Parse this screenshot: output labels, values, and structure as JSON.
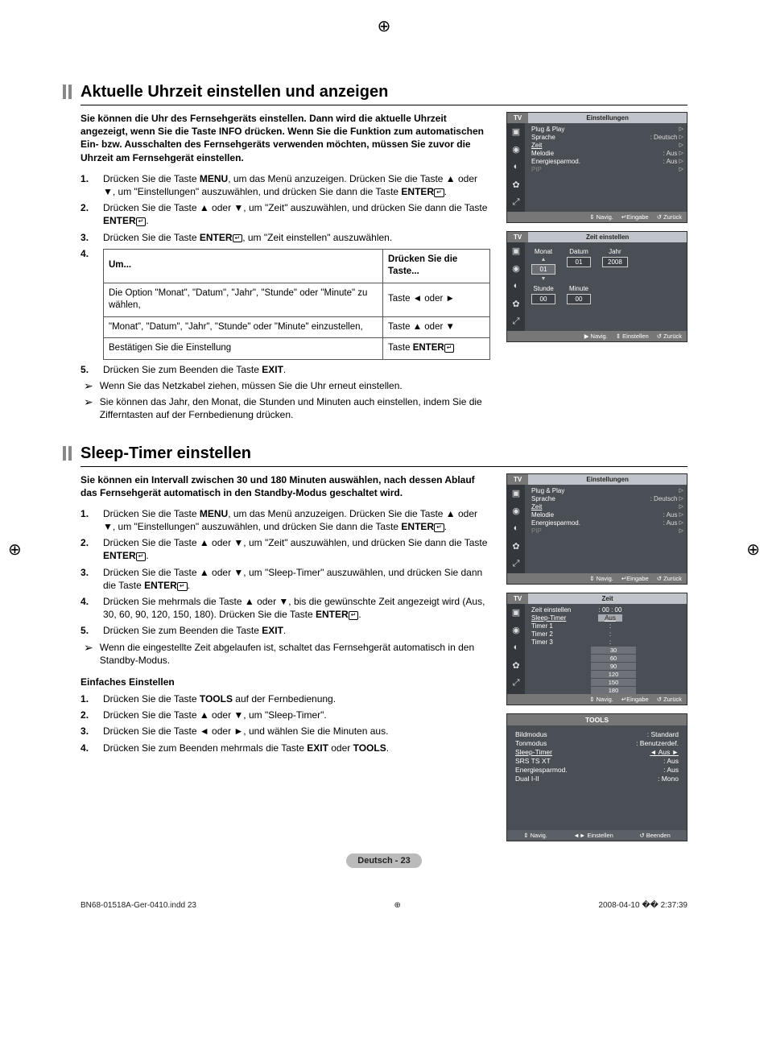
{
  "sections": [
    {
      "title": "Aktuelle Uhrzeit einstellen und anzeigen",
      "intro": "Sie können die Uhr des Fernsehgeräts einstellen. Dann wird die aktuelle Uhrzeit angezeigt, wenn Sie die Taste INFO drücken. Wenn Sie die Funktion zum automatischen Ein- bzw. Ausschalten des Fernsehgeräts verwenden möchten, müssen Sie zuvor die Uhrzeit am Fernsehgerät einstellen.",
      "steps": [
        "Drücken Sie die Taste **MENU**, um das Menü anzuzeigen. Drücken Sie die Taste ▲ oder ▼, um \"Einstellungen\" auszuwählen, und drücken Sie dann die Taste **ENTER**↵.",
        "Drücken Sie die Taste ▲ oder ▼, um \"Zeit\" auszuwählen, und drücken Sie dann die Taste **ENTER**↵.",
        "Drücken Sie die Taste **ENTER**↵, um \"Zeit einstellen\" auszuwählen."
      ],
      "table": {
        "headers": [
          "Um...",
          "Drücken Sie die Taste..."
        ],
        "rows": [
          [
            "Die Option \"Monat\", \"Datum\", \"Jahr\", \"Stunde\" oder \"Minute\" zu wählen,",
            "Taste ◄ oder ►"
          ],
          [
            "\"Monat\", \"Datum\", \"Jahr\", \"Stunde\" oder \"Minute\" einzustellen,",
            "Taste ▲ oder ▼"
          ],
          [
            "Bestätigen Sie die Einstellung",
            "Taste **ENTER**↵"
          ]
        ]
      },
      "step5": "Drücken Sie zum Beenden die Taste **EXIT**.",
      "notes": [
        "Wenn Sie das Netzkabel ziehen, müssen Sie die Uhr erneut einstellen.",
        "Sie können das Jahr, den Monat, die Stunden und Minuten auch einstellen, indem Sie die Zifferntasten auf der Fernbedienung drücken."
      ]
    },
    {
      "title": "Sleep-Timer einstellen",
      "intro": "Sie können ein Intervall zwischen 30 und 180 Minuten auswählen, nach dessen Ablauf das Fernsehgerät automatisch in den Standby-Modus geschaltet wird.",
      "steps": [
        "Drücken Sie die Taste **MENU**, um das Menü anzuzeigen. Drücken Sie die Taste ▲ oder ▼, um \"Einstellungen\" auszuwählen, und drücken Sie dann die Taste **ENTER**↵.",
        "Drücken Sie die Taste ▲ oder ▼, um \"Zeit\" auszuwählen, und drücken Sie dann die Taste **ENTER**↵.",
        "Drücken Sie die Taste ▲ oder ▼, um \"Sleep-Timer\" auszuwählen, und drücken Sie dann die Taste **ENTER**↵.",
        "Drücken Sie mehrmals die Taste ▲ oder ▼, bis die gewünschte Zeit angezeigt wird (Aus, 30, 60, 90, 120, 150, 180). Drücken Sie die Taste **ENTER**↵.",
        "Drücken Sie zum Beenden die Taste **EXIT**."
      ],
      "notes": [
        "Wenn die eingestellte Zeit abgelaufen ist, schaltet das Fernsehgerät automatisch in den Standby-Modus."
      ],
      "subhead": "Einfaches Einstellen",
      "substeps": [
        "Drücken Sie die Taste **TOOLS** auf der Fernbedienung.",
        "Drücken Sie die Taste ▲ oder ▼, um \"Sleep-Timer\".",
        "Drücken Sie die Taste ◄ oder ►, und wählen Sie die Minuten aus.",
        "Drücken Sie zum Beenden mehrmals die Taste **EXIT** oder **TOOLS**."
      ]
    }
  ],
  "osd": {
    "settings": {
      "tab": "TV",
      "title": "Einstellungen",
      "items": [
        {
          "k": "Plug & Play",
          "v": ""
        },
        {
          "k": "Sprache",
          "v": ": Deutsch"
        },
        {
          "k": "Zeit",
          "v": "",
          "hl": true
        },
        {
          "k": "Melodie",
          "v": ": Aus"
        },
        {
          "k": "Energiesparmod.",
          "v": ": Aus"
        },
        {
          "k": "PIP",
          "v": "",
          "dim": true
        }
      ],
      "footer": [
        "⇕ Navig.",
        "↵Eingabe",
        "↺ Zurück"
      ]
    },
    "zeit_einstellen": {
      "tab": "TV",
      "title": "Zeit einstellen",
      "cols": [
        {
          "label": "Monat",
          "val": "01",
          "hl": true,
          "arrows": true
        },
        {
          "label": "Datum",
          "val": "01"
        },
        {
          "label": "Jahr",
          "val": "2008"
        }
      ],
      "cols2": [
        {
          "label": "Stunde",
          "val": "00"
        },
        {
          "label": "Minute",
          "val": "00"
        }
      ],
      "footer": [
        "▶ Navig.",
        "⇕ Einstellen",
        "↺ Zurück"
      ]
    },
    "zeit_menu": {
      "tab": "TV",
      "title": "Zeit",
      "rows": [
        {
          "k": "Zeit einstellen",
          "v": ": 00 : 00"
        },
        {
          "k": "Sleep-Timer",
          "v": "Aus",
          "hl": true
        },
        {
          "k": "Timer 1",
          "v": ":"
        },
        {
          "k": "Timer 2",
          "v": ":"
        },
        {
          "k": "Timer 3",
          "v": ":"
        }
      ],
      "options": [
        "30",
        "60",
        "90",
        "120",
        "150",
        "180"
      ],
      "footer": [
        "⇕ Navig.",
        "↵Eingabe",
        "↺ Zurück"
      ]
    },
    "tools": {
      "title": "TOOLS",
      "rows": [
        {
          "k": "Bildmodus",
          "v": ": Standard"
        },
        {
          "k": "Tonmodus",
          "v": ": Benutzerdef."
        },
        {
          "k": "Sleep-Timer",
          "v": "◄ Aus      ►",
          "hl": true
        },
        {
          "k": "SRS TS XT",
          "v": ": Aus"
        },
        {
          "k": "Energiesparmod.",
          "v": ": Aus"
        },
        {
          "k": "Dual I-II",
          "v": ": Mono"
        }
      ],
      "footer": [
        "⇕ Navig.",
        "◄► Einstellen",
        "↺ Beenden"
      ]
    }
  },
  "page_label": "Deutsch - 23",
  "footer": {
    "left": "BN68-01518A-Ger-0410.indd   23",
    "right": "2008-04-10   �� 2:37:39"
  }
}
